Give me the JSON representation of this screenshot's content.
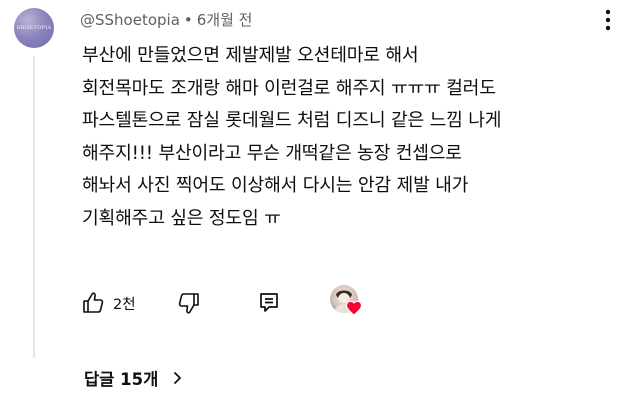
{
  "comment": {
    "avatar_text": "SHOETOPIA",
    "author": "@SShoetopia",
    "separator": "•",
    "time": "6개월 전",
    "lines": [
      "부산에 만들었으면 제발제발 오션테마로 해서",
      "회전목마도 조개랑 해마 이런걸로 해주지 ㅠㅠㅠ 컬러도",
      "파스텔톤으로 잠실 롯데월드 처럼 디즈니 같은 느낌 나게",
      "해주지!!! 부산이라고 무슨 개떡같은 농장 컨셉으로",
      "해놔서 사진 찍어도 이상해서 다시는 안감 제발 내가",
      "기획해주고 싶은 정도임 ㅠ"
    ],
    "like_count": "2천"
  },
  "replies": {
    "label": "답글 15개"
  },
  "icons": {
    "more": "more-vertical-icon",
    "like": "thumbs-up-icon",
    "dislike": "thumbs-down-icon",
    "reply": "reply-icon",
    "heart": "heart-icon",
    "chevron": "chevron-right-icon"
  },
  "colors": {
    "heart": "#ff0033",
    "muted_text": "#606060",
    "text": "#0f0f0f"
  }
}
